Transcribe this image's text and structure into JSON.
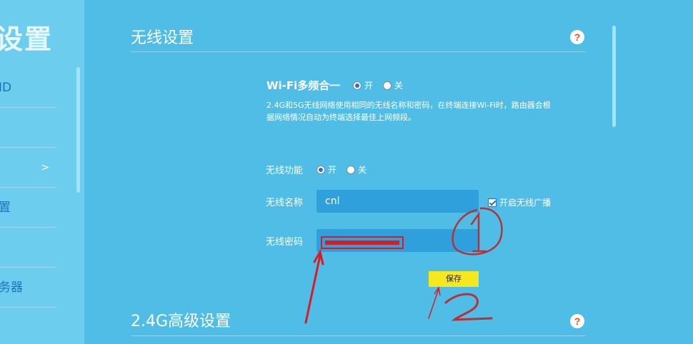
{
  "sidebar": {
    "title": "设置",
    "items": [
      {
        "label": "ID"
      },
      {
        "label": ""
      },
      {
        "label": "",
        "chevron": ">"
      },
      {
        "label": "置"
      },
      {
        "label": ""
      },
      {
        "label": "务器"
      }
    ]
  },
  "wireless": {
    "title": "无线设置",
    "help_glyph": "?",
    "multi_band_label": "Wi-Fi多频合一",
    "multi_band_on": "开",
    "multi_band_off": "关",
    "description": "2.4G和5G无线网络使用相同的无线名称和密码，在终端连接Wi-Fi时，路由器会根据网络情况自动为终端选择最佳上网频段。",
    "function_label": "无线功能",
    "function_on": "开",
    "function_off": "关",
    "name_label": "无线名称",
    "name_value": "cnl",
    "broadcast_label": "开启无线广播",
    "password_label": "无线密码",
    "save_label": "保存"
  },
  "advanced": {
    "title": "2.4G高级设置",
    "help_glyph": "?"
  },
  "colors": {
    "background": "#4fbde5",
    "sidebar": "#6dcdee",
    "input": "#2fa0dc",
    "save_button": "#f6e81f",
    "annotation": "#d81c24"
  }
}
